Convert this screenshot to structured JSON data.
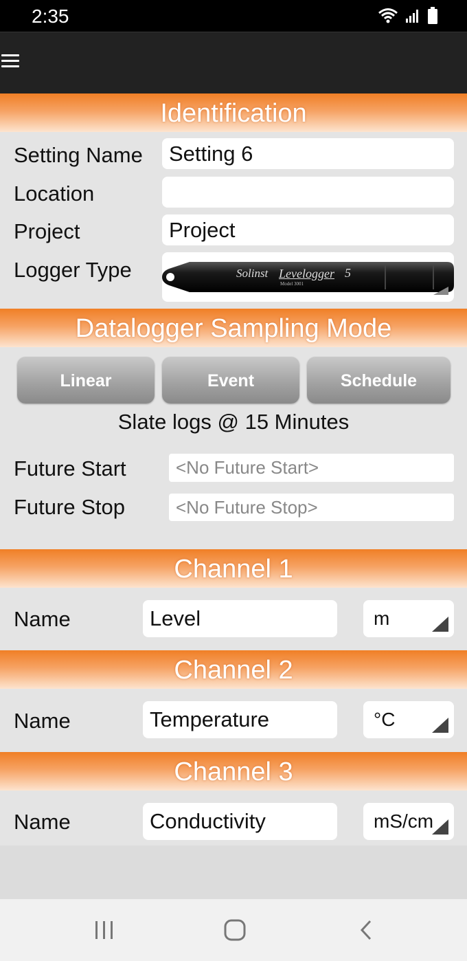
{
  "status_bar": {
    "time": "2:35"
  },
  "sections": {
    "identification": "Identification",
    "sampling": "Datalogger Sampling Mode",
    "channel1": "Channel 1",
    "channel2": "Channel 2",
    "channel3": "Channel 3"
  },
  "identification": {
    "setting_name_label": "Setting Name",
    "setting_name_value": "Setting 6",
    "location_label": "Location",
    "location_value": "",
    "project_label": "Project",
    "project_value": "Project",
    "logger_type_label": "Logger Type",
    "logger_brand": "Solinst",
    "logger_model": "Levelogger",
    "logger_model_suffix": "5",
    "logger_model_number": "Model 3001"
  },
  "sampling": {
    "buttons": [
      "Linear",
      "Event",
      "Schedule"
    ],
    "summary": "Slate logs @  15 Minutes",
    "future_start_label": "Future Start",
    "future_start_placeholder": "<No Future Start>",
    "future_stop_label": "Future Stop",
    "future_stop_placeholder": "<No Future Stop>"
  },
  "channels": [
    {
      "name_label": "Name",
      "name": "Level",
      "unit": "m"
    },
    {
      "name_label": "Name",
      "name": "Temperature",
      "unit": "°C"
    },
    {
      "name_label": "Name",
      "name": "Conductivity",
      "unit": "mS/cm"
    }
  ],
  "colors": {
    "header_orange": "#f07f26",
    "app_bar": "#222222",
    "background": "#e4e4e4"
  }
}
